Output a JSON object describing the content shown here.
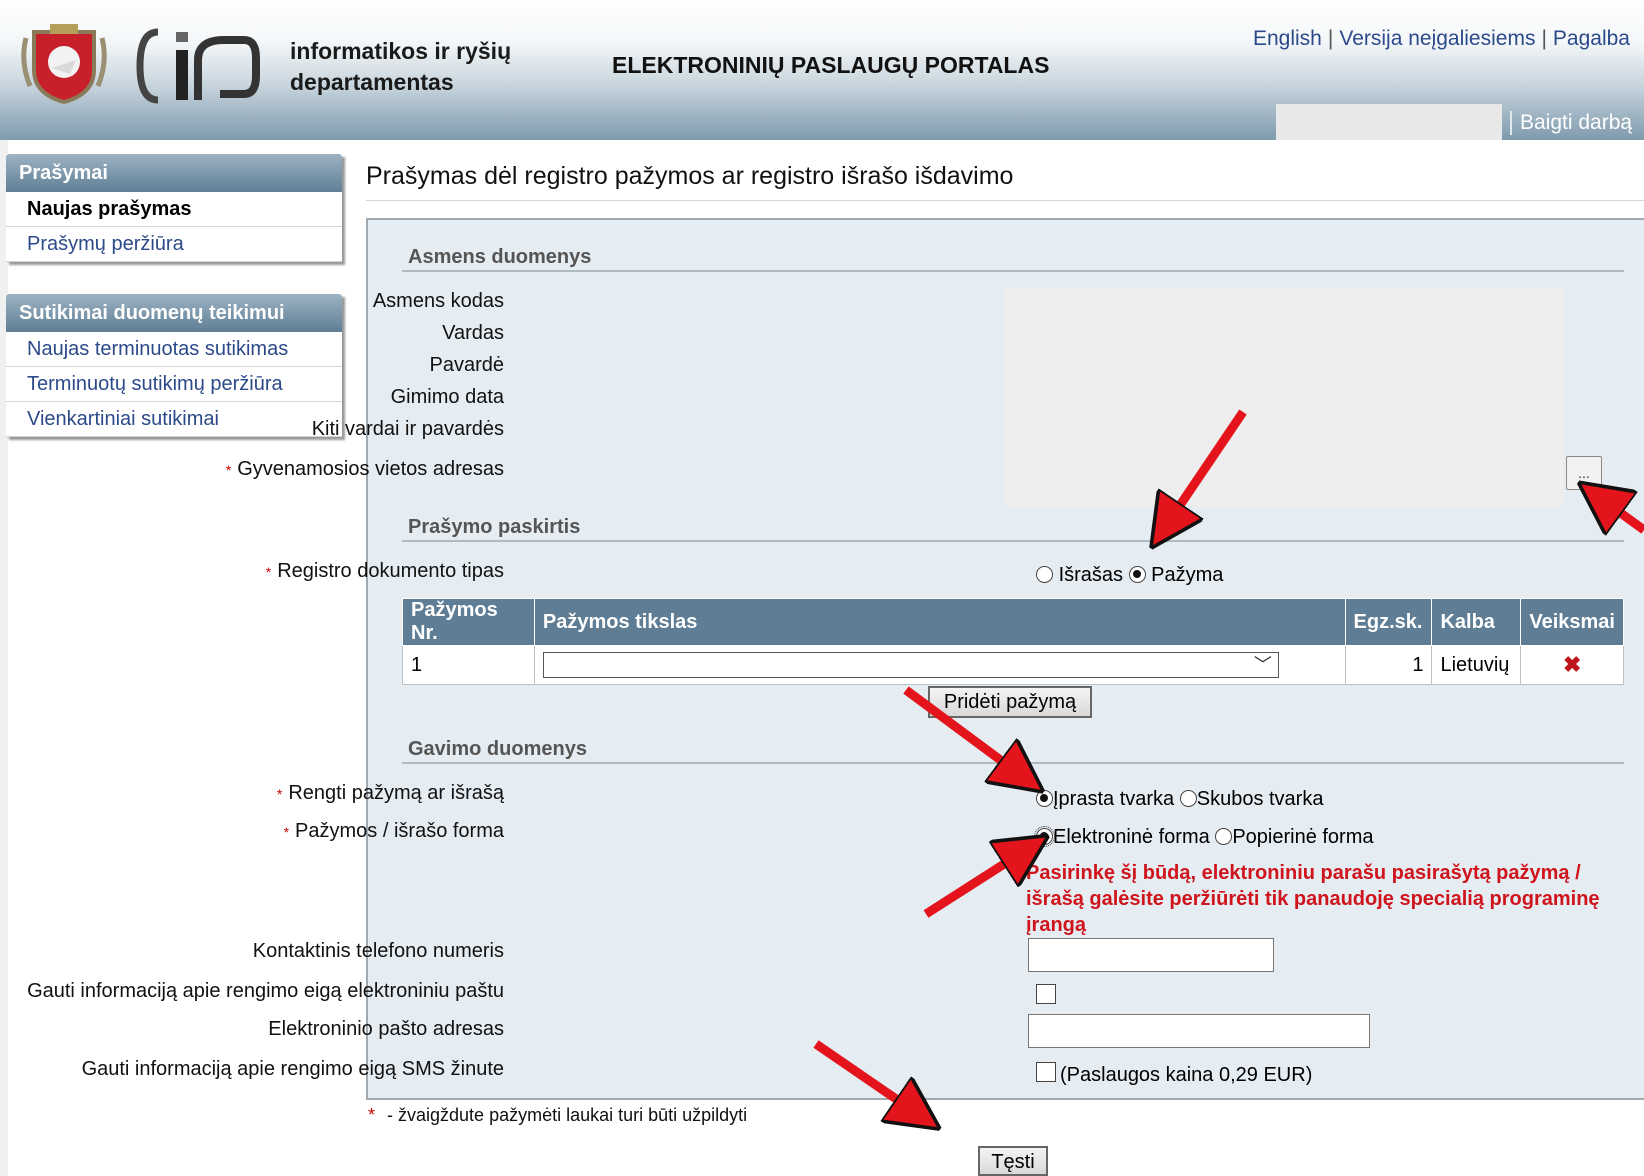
{
  "header": {
    "org_name_line1": "informatikos ir ryšių",
    "org_name_line2": "departamentas",
    "portal_title": "ELEKTRONINIŲ PASLAUGŲ PORTALAS",
    "links": [
      "English",
      "Versija neįgaliesiems",
      "Pagalba"
    ],
    "logout": "Baigti darbą"
  },
  "sidebar": {
    "groups": [
      {
        "title": "Prašymai",
        "items": [
          "Naujas prašymas",
          "Prašymų peržiūra"
        ]
      },
      {
        "title": "Sutikimai duomenų teikimui",
        "items": [
          "Naujas terminuotas sutikimas",
          "Terminuotų sutikimų peržiūra",
          "Vienkartiniai sutikimai"
        ]
      }
    ]
  },
  "page": {
    "title": "Prašymas dėl registro pažymos ar registro išrašo išdavimo"
  },
  "personal": {
    "section": "Asmens duomenys",
    "labels": [
      "Asmens kodas",
      "Vardas",
      "Pavardė",
      "Gimimo data",
      "Kiti vardai ir pavardės",
      "Gyvenamosios vietos adresas"
    ],
    "address_button": "..."
  },
  "purpose": {
    "section": "Prašymo paskirtis",
    "doc_type_label": "Registro dokumento tipas",
    "options": [
      "Išrašas",
      "Pažyma"
    ],
    "selected": "Pažyma",
    "table": {
      "headers": [
        "Pažymos Nr.",
        "Pažymos tikslas",
        "Egz.sk.",
        "Kalba",
        "Veiksmai"
      ],
      "rows": [
        {
          "nr": "1",
          "purpose": "",
          "copies": "1",
          "language": "Lietuvių",
          "action_icon": "delete-x-icon"
        }
      ]
    },
    "add_button": "Pridėti pažymą"
  },
  "delivery": {
    "section": "Gavimo duomenys",
    "prepare_label": "Rengti pažymą ar išrašą",
    "prepare_options": [
      "Įprasta tvarka",
      "Skubos tvarka"
    ],
    "prepare_selected": "Įprasta tvarka",
    "form_label": "Pažymos / išrašo forma",
    "form_options": [
      "Elektroninė forma",
      "Popierinė forma"
    ],
    "form_selected": "Elektroninė forma",
    "warning": "Pasirinkę šį būdą, elektroniniu parašu pasirašytą pažymą / išrašą galėsite peržiūrėti tik panaudoję specialią programinę įrangą",
    "phone_label": "Kontaktinis telefono numeris",
    "phone_value": "",
    "email_notify_label": "Gauti informaciją apie rengimo eigą elektroniniu paštu",
    "email_notify_checked": false,
    "email_label": "Elektroninio pašto adresas",
    "email_value": "",
    "sms_label": "Gauti informaciją apie rengimo eigą SMS žinute",
    "sms_checked": false,
    "sms_price": "(Paslaugos kaina 0,29 EUR)"
  },
  "footer": {
    "required_note": "- žvaigždute pažymėti laukai turi būti užpildyti",
    "required_star": "*",
    "continue_button": "Tęsti"
  },
  "colors": {
    "header_blue": "#5f7e95",
    "warning_red": "#d0141c",
    "panel_bg": "#e5ecf2",
    "link_blue": "#2c4a8a",
    "arrow_red": "#e3141b"
  }
}
